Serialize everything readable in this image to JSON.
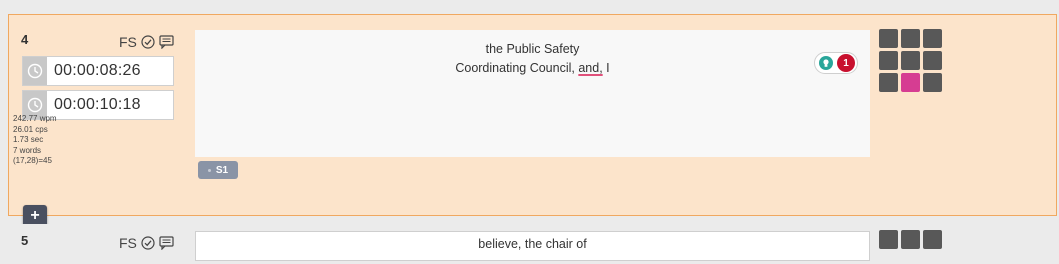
{
  "rows": [
    {
      "number": "4",
      "fs_label": "FS",
      "start_time": "00:00:08:26",
      "end_time": "00:00:10:18",
      "stats": [
        "242.77 wpm",
        "26.01 cps",
        "1.73 sec",
        "7 words",
        "(17,28)=45"
      ],
      "text_line1": "the Public Safety",
      "text_line2_before": "Coordinating Council, ",
      "text_line2_marked": "and,",
      "text_line2_after": " I",
      "hint_count": "1",
      "speaker": "S1",
      "grid_active_index": 7
    },
    {
      "number": "5",
      "fs_label": "FS",
      "text_line1": "believe, the chair of"
    }
  ],
  "add_button_label": "+",
  "colors": {
    "active_row_bg": "#fce4cb",
    "active_row_border": "#f0a860",
    "grid_cell": "#585858",
    "grid_active": "#d63d92",
    "hint_badge": "#c8102e",
    "hint_bulb": "#2aa69a",
    "speaker_tag": "#8a94a6"
  },
  "icons": [
    "check-circle-icon",
    "comment-icon",
    "clock-icon",
    "lightbulb-icon",
    "plus-icon"
  ]
}
